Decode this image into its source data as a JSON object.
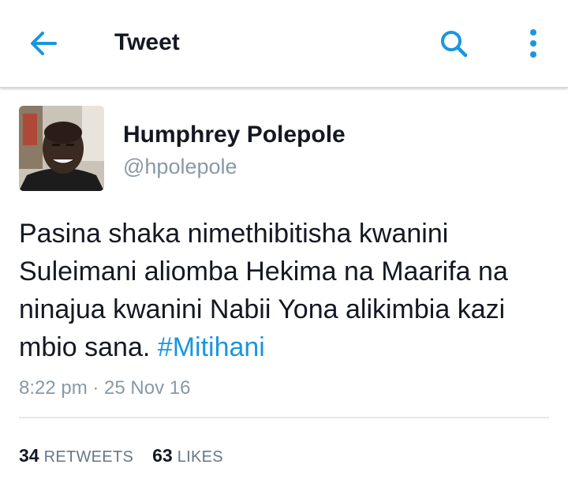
{
  "header": {
    "title": "Tweet",
    "back_icon": "arrow-left-icon",
    "search_icon": "search-icon",
    "more_icon": "more-vertical-icon"
  },
  "tweet": {
    "author_name": "Humphrey Polepole",
    "author_handle": "@hpolepole",
    "text": "Pasina shaka nimethibitisha kwanini Suleimani aliomba Hekima na Maarifa na ninajua kwanini Nabii Yona alikimbia kazi mbio sana.",
    "hashtag": "#Mitihani",
    "timestamp": "8:22 pm · 25 Nov 16"
  },
  "stats": {
    "retweets_count": "34",
    "retweets_label": "RETWEETS",
    "likes_count": "63",
    "likes_label": "LIKES"
  },
  "colors": {
    "accent": "#1b95e0",
    "text_primary": "#141823",
    "text_secondary": "#8899a6"
  }
}
